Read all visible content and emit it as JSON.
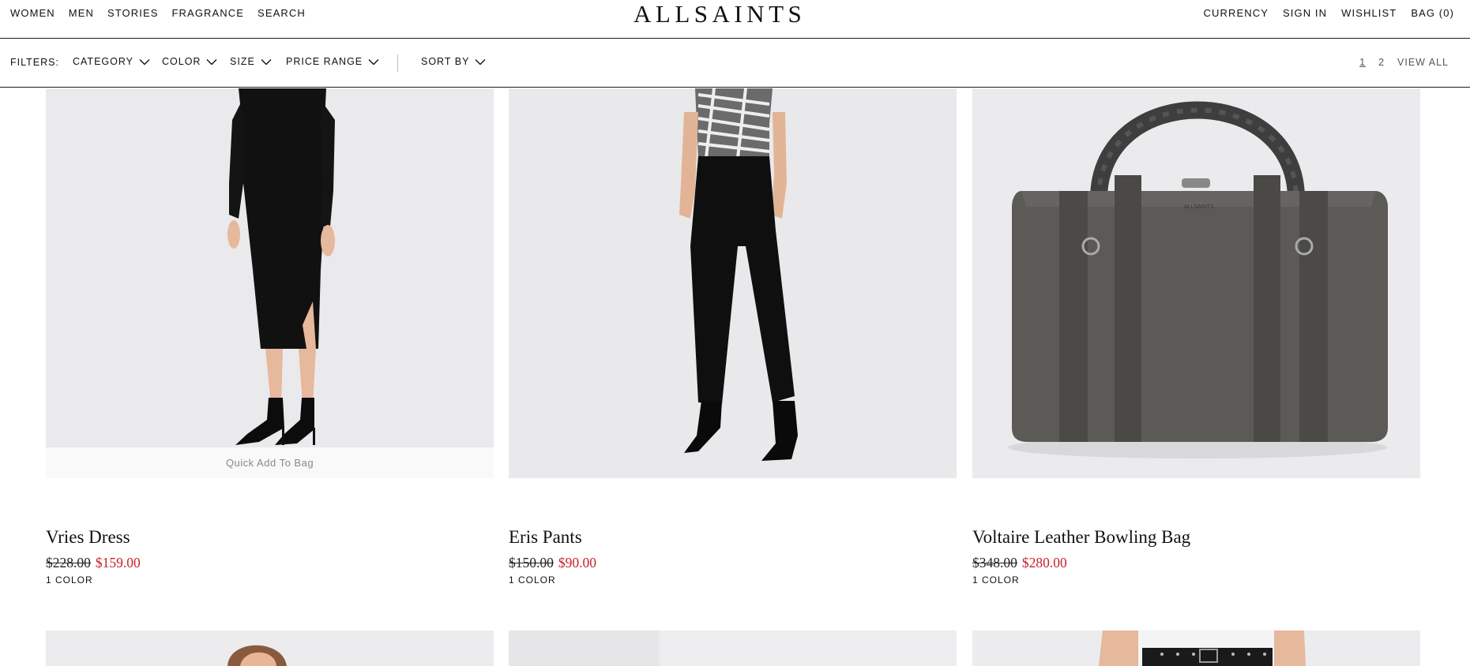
{
  "header": {
    "left_nav": [
      "WOMEN",
      "MEN",
      "STORIES",
      "FRAGRANCE",
      "SEARCH"
    ],
    "logo": "ALLSAINTS",
    "right_nav": [
      "CURRENCY",
      "SIGN IN",
      "WISHLIST",
      "BAG (0)"
    ]
  },
  "filters": {
    "label": "FILTERS:",
    "items": [
      "CATEGORY",
      "COLOR",
      "SIZE",
      "PRICE RANGE"
    ],
    "sort": "SORT BY",
    "pages": [
      "1",
      "2"
    ],
    "view_all": "VIEW ALL"
  },
  "products": [
    {
      "name": "Vries Dress",
      "old_price": "$228.00",
      "new_price": "$159.00",
      "colors": "1 COLOR",
      "quick_add": "Quick Add To Bag"
    },
    {
      "name": "Eris Pants",
      "old_price": "$150.00",
      "new_price": "$90.00",
      "colors": "1 COLOR"
    },
    {
      "name": "Voltaire Leather Bowling Bag",
      "old_price": "$348.00",
      "new_price": "$280.00",
      "colors": "1 COLOR"
    }
  ],
  "colors": {
    "sale_red": "#c8202b",
    "image_bg": "#e9e9eb",
    "border": "#1a1a1a"
  }
}
